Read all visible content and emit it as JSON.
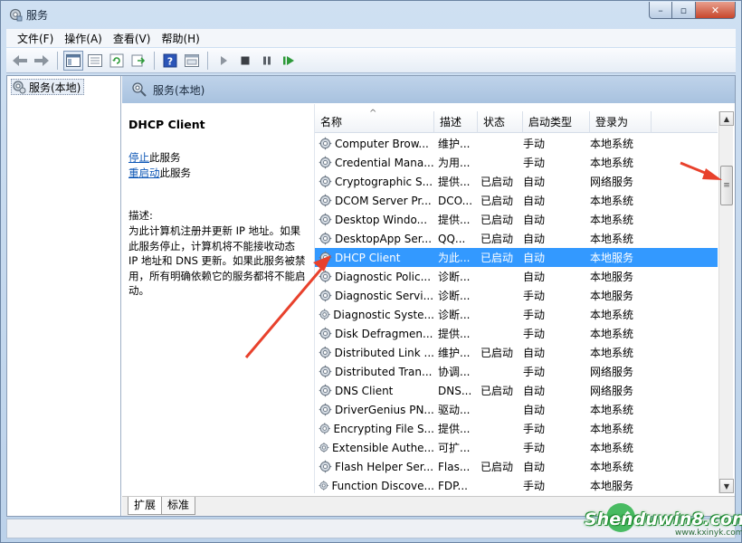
{
  "window": {
    "title": "服务"
  },
  "menu": [
    "文件(F)",
    "操作(A)",
    "查看(V)",
    "帮助(H)"
  ],
  "tree": {
    "root_label": "服务(本地)"
  },
  "pane": {
    "header": "服务(本地)"
  },
  "detail": {
    "title": "DHCP Client",
    "stop_link": "停止",
    "stop_suffix": "此服务",
    "restart_link": "重启动",
    "restart_suffix": "此服务",
    "desc_label": "描述:",
    "desc_text": "为此计算机注册并更新 IP 地址。如果此服务停止，计算机将不能接收动态 IP 地址和 DNS 更新。如果此服务被禁用，所有明确依赖它的服务都将不能启动。"
  },
  "columns": {
    "name": "名称",
    "desc": "描述",
    "status": "状态",
    "startup": "启动类型",
    "logon": "登录为"
  },
  "rows": [
    {
      "name": "Computer Brow...",
      "desc": "维护...",
      "status": "",
      "startup": "手动",
      "logon": "本地系统"
    },
    {
      "name": "Credential Mana...",
      "desc": "为用...",
      "status": "",
      "startup": "手动",
      "logon": "本地系统"
    },
    {
      "name": "Cryptographic S...",
      "desc": "提供...",
      "status": "已启动",
      "startup": "自动",
      "logon": "网络服务"
    },
    {
      "name": "DCOM Server Pr...",
      "desc": "DCO...",
      "status": "已启动",
      "startup": "自动",
      "logon": "本地系统"
    },
    {
      "name": "Desktop Windo...",
      "desc": "提供...",
      "status": "已启动",
      "startup": "自动",
      "logon": "本地系统"
    },
    {
      "name": "DesktopApp Ser...",
      "desc": "QQ...",
      "status": "已启动",
      "startup": "自动",
      "logon": "本地系统"
    },
    {
      "name": "DHCP Client",
      "desc": "为此...",
      "status": "已启动",
      "startup": "自动",
      "logon": "本地服务",
      "selected": true
    },
    {
      "name": "Diagnostic Polic...",
      "desc": "诊断...",
      "status": "",
      "startup": "自动",
      "logon": "本地服务"
    },
    {
      "name": "Diagnostic Servi...",
      "desc": "诊断...",
      "status": "",
      "startup": "手动",
      "logon": "本地服务"
    },
    {
      "name": "Diagnostic Syste...",
      "desc": "诊断...",
      "status": "",
      "startup": "手动",
      "logon": "本地系统"
    },
    {
      "name": "Disk Defragmen...",
      "desc": "提供...",
      "status": "",
      "startup": "手动",
      "logon": "本地系统"
    },
    {
      "name": "Distributed Link ...",
      "desc": "维护...",
      "status": "已启动",
      "startup": "自动",
      "logon": "本地系统"
    },
    {
      "name": "Distributed Tran...",
      "desc": "协调...",
      "status": "",
      "startup": "手动",
      "logon": "网络服务"
    },
    {
      "name": "DNS Client",
      "desc": "DNS...",
      "status": "已启动",
      "startup": "自动",
      "logon": "网络服务"
    },
    {
      "name": "DriverGenius PN...",
      "desc": "驱动...",
      "status": "",
      "startup": "自动",
      "logon": "本地系统"
    },
    {
      "name": "Encrypting File S...",
      "desc": "提供...",
      "status": "",
      "startup": "手动",
      "logon": "本地系统"
    },
    {
      "name": "Extensible Authe...",
      "desc": "可扩...",
      "status": "",
      "startup": "手动",
      "logon": "本地系统"
    },
    {
      "name": "Flash Helper Ser...",
      "desc": "Flas...",
      "status": "已启动",
      "startup": "自动",
      "logon": "本地系统"
    },
    {
      "name": "Function Discove...",
      "desc": "FDP...",
      "status": "",
      "startup": "手动",
      "logon": "本地服务"
    }
  ],
  "tabs": [
    "扩展",
    "标准"
  ],
  "watermark": {
    "text": "Shenduwin8.com",
    "sub": "www.kxinyk.com"
  },
  "colors": {
    "selection": "#3399ff",
    "annotation": "#e8412c",
    "link": "#0b55b5"
  }
}
